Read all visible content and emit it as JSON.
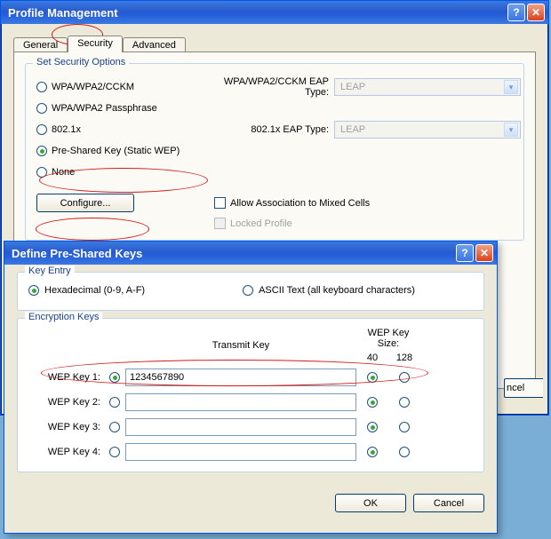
{
  "main": {
    "title": "Profile Management",
    "tabs": {
      "general": "General",
      "security": "Security",
      "advanced": "Advanced"
    },
    "group_title": "Set Security Options",
    "radios": {
      "wpa": "WPA/WPA2/CCKM",
      "pass": "WPA/WPA2 Passphrase",
      "dot1x": "802.1x",
      "psk": "Pre-Shared Key (Static WEP)",
      "none": "None"
    },
    "eap1_label": "WPA/WPA2/CCKM EAP Type:",
    "eap2_label": "802.1x EAP Type:",
    "eap_value": "LEAP",
    "chk_mixed": "Allow Association to Mixed Cells",
    "chk_locked": "Locked Profile",
    "configure": "Configure...",
    "cancel_peek": "ncel"
  },
  "sub": {
    "title": "Define Pre-Shared Keys",
    "keyentry_title": "Key Entry",
    "hex": "Hexadecimal (0-9, A-F)",
    "ascii": "ASCII Text (all keyboard characters)",
    "enc_title": "Encryption Keys",
    "transmit": "Transmit Key",
    "size_title": "WEP Key Size:",
    "c40": "40",
    "c128": "128",
    "k1": "WEP Key 1:",
    "k2": "WEP Key 2:",
    "k3": "WEP Key 3:",
    "k4": "WEP Key 4:",
    "v1": "1234567890",
    "ok": "OK",
    "cancel": "Cancel"
  }
}
